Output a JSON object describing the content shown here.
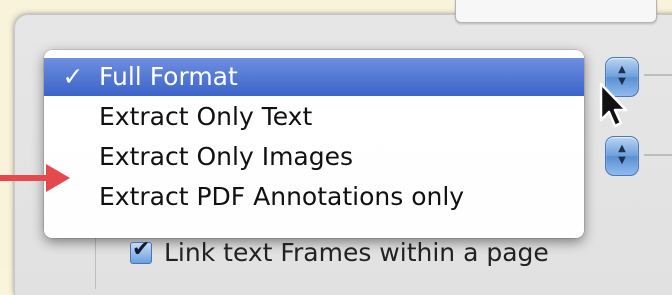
{
  "menu": {
    "items": [
      {
        "check": "✓",
        "label": "Full Format",
        "selected": true
      },
      {
        "check": "",
        "label": "Extract Only Text",
        "selected": false
      },
      {
        "check": "",
        "label": "Extract Only Images",
        "selected": false
      },
      {
        "check": "",
        "label": "Extract PDF Annotations only",
        "selected": false
      }
    ]
  },
  "option": {
    "checkbox_mark": "✔",
    "label": "Link text Frames within a page",
    "checked": true
  },
  "icons": {
    "stepper": "stepper-arrows-icon",
    "cursor": "mouse-pointer-icon",
    "annotation": "red-arrow-icon"
  },
  "colors": {
    "background": "#faf3dc",
    "selection": "#3b63c9",
    "annotation_arrow": "#e5484d"
  }
}
